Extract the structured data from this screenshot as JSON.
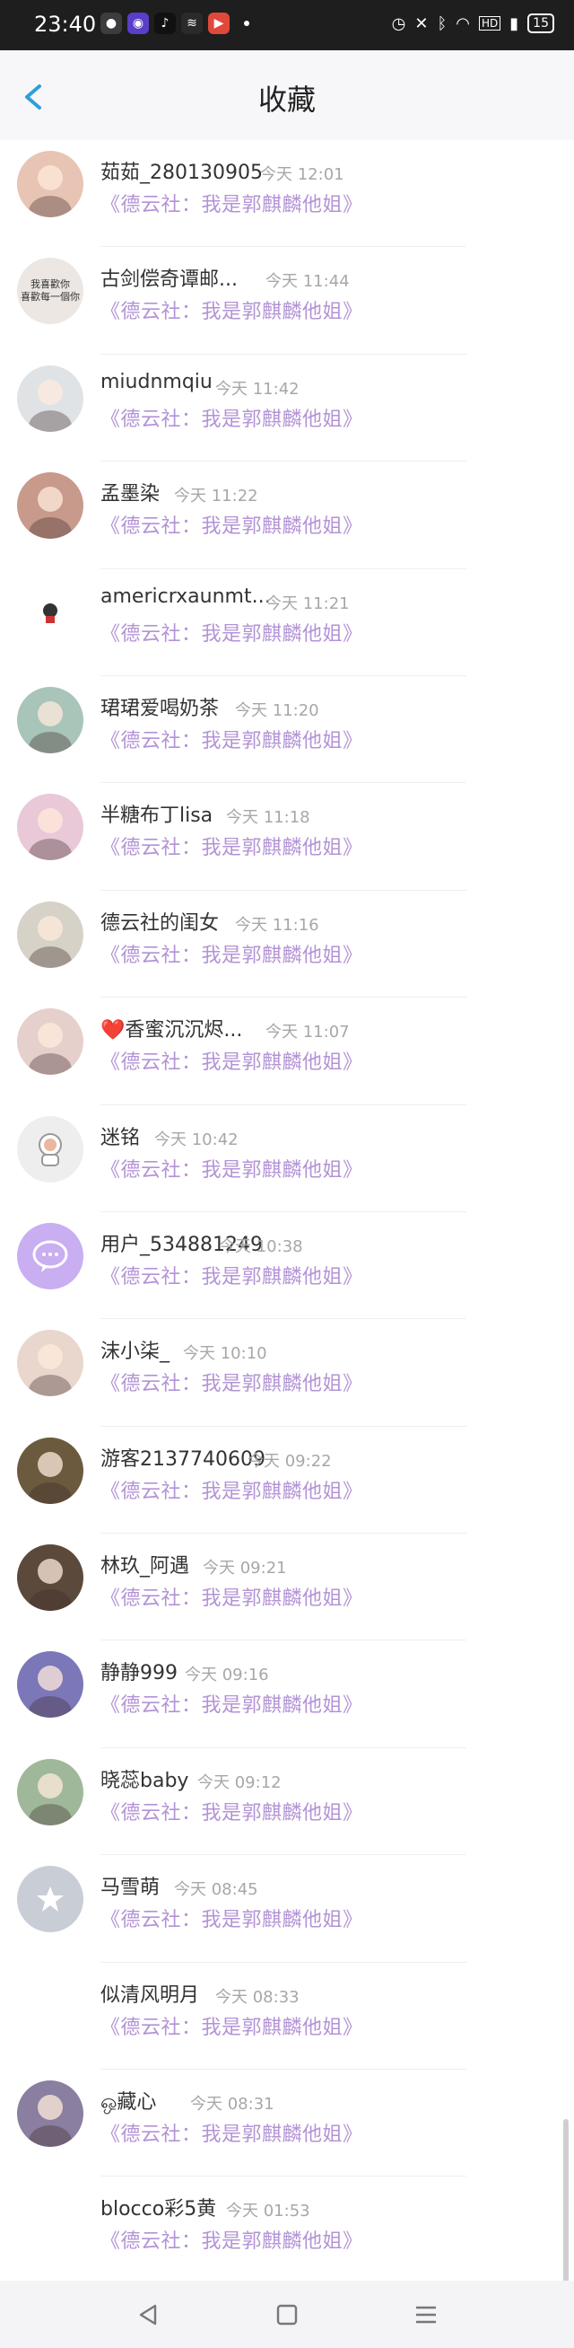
{
  "status_bar": {
    "time": "23:40",
    "battery": "15"
  },
  "header": {
    "title": "收藏"
  },
  "items": [
    {
      "name": "茹茹_280130905",
      "time": "今天 12:01",
      "msg": "《德云社：我是郭麒麟他姐》",
      "avatar_color": "#e8c4b4",
      "avatar_icon": "photo-avatar-icon"
    },
    {
      "name": "古剑偿奇谭邮...",
      "time": "今天 11:44",
      "msg": "《德云社：我是郭麒麟他姐》",
      "avatar_color": "#ece7e2",
      "avatar_icon": "text-image-avatar-icon",
      "avatar_text": "我喜歡你\n喜歡每一個你"
    },
    {
      "name": "miudnmqiu",
      "time": "今天 11:42",
      "msg": "《德云社：我是郭麒麟他姐》",
      "avatar_color": "#dfe3e6",
      "avatar_icon": "photo-avatar-icon"
    },
    {
      "name": "孟墨染",
      "time": "今天 11:22",
      "msg": "《德云社：我是郭麒麟他姐》",
      "avatar_color": "#c79a8c",
      "avatar_icon": "photo-avatar-icon"
    },
    {
      "name": "americrxaunmt...",
      "time": "今天 11:21",
      "msg": "《德云社：我是郭麒麟他姐》",
      "avatar_color": "#ffffff",
      "avatar_icon": "character-avatar-icon"
    },
    {
      "name": "珺珺爱喝奶茶",
      "time": "今天 11:20",
      "msg": "《德云社：我是郭麒麟他姐》",
      "avatar_color": "#a9c4b8",
      "avatar_icon": "photo-avatar-icon"
    },
    {
      "name": "半糖布丁lisa",
      "time": "今天 11:18",
      "msg": "《德云社：我是郭麒麟他姐》",
      "avatar_color": "#e9c8d8",
      "avatar_icon": "photo-avatar-icon"
    },
    {
      "name": "德云社的闺女",
      "time": "今天 11:16",
      "msg": "《德云社：我是郭麒麟他姐》",
      "avatar_color": "#d6d2c8",
      "avatar_icon": "photo-avatar-icon"
    },
    {
      "name": "❤️香蜜沉沉烬...",
      "time": "今天 11:07",
      "msg": "《德云社：我是郭麒麟他姐》",
      "avatar_color": "#e6d0cc",
      "avatar_icon": "photo-avatar-icon"
    },
    {
      "name": "迷铭",
      "time": "今天 10:42",
      "msg": "《德云社：我是郭麒麟他姐》",
      "avatar_color": "#eeeeee",
      "avatar_icon": "astronaut-avatar-icon"
    },
    {
      "name": "用户_534881249",
      "time": "今天 10:38",
      "msg": "《德云社：我是郭麒麟他姐》",
      "avatar_color": "#c9aef2",
      "avatar_icon": "chat-bubble-avatar-icon"
    },
    {
      "name": "沫小柒_",
      "time": "今天 10:10",
      "msg": "《德云社：我是郭麒麟他姐》",
      "avatar_color": "#e9d6cc",
      "avatar_icon": "photo-avatar-icon"
    },
    {
      "name": "游客2137740609",
      "time": "今天 09:22",
      "msg": "《德云社：我是郭麒麟他姐》",
      "avatar_color": "#6b5a3e",
      "avatar_icon": "photo-avatar-icon"
    },
    {
      "name": "林玖_阿遇",
      "time": "今天 09:21",
      "msg": "《德云社：我是郭麒麟他姐》",
      "avatar_color": "#5b4a3c",
      "avatar_icon": "photo-avatar-icon"
    },
    {
      "name": "静静999",
      "time": "今天 09:16",
      "msg": "《德云社：我是郭麒麟他姐》",
      "avatar_color": "#7b77b8",
      "avatar_icon": "photo-avatar-icon"
    },
    {
      "name": "晓蕊baby",
      "time": "今天 09:12",
      "msg": "《德云社：我是郭麒麟他姐》",
      "avatar_color": "#9fb89a",
      "avatar_icon": "photo-avatar-icon"
    },
    {
      "name": "马雪萌",
      "time": "今天 08:45",
      "msg": "《德云社：我是郭麒麟他姐》",
      "avatar_color": "#c9ced6",
      "avatar_icon": "star-avatar-icon"
    },
    {
      "name": "似清风明月",
      "time": "今天 08:33",
      "msg": "《德云社：我是郭麒麟他姐》",
      "avatar_color": "",
      "avatar_icon": ""
    },
    {
      "name": "ஒ藏心",
      "time": "今天 08:31",
      "msg": "《德云社：我是郭麒麟他姐》",
      "avatar_color": "#8a7fa0",
      "avatar_icon": "photo-avatar-icon"
    },
    {
      "name": "blocco彩5黄",
      "time": "今天 01:53",
      "msg": "《德云社：我是郭麒麟他姐》",
      "avatar_color": "",
      "avatar_icon": ""
    }
  ],
  "colors": {
    "accent": "#2f9fd8",
    "message": "#b393d6",
    "time": "#a7a7a7"
  },
  "nav": {
    "back_icon": "triangle-back-icon",
    "home_icon": "square-home-icon",
    "menu_icon": "menu-lines-icon"
  }
}
